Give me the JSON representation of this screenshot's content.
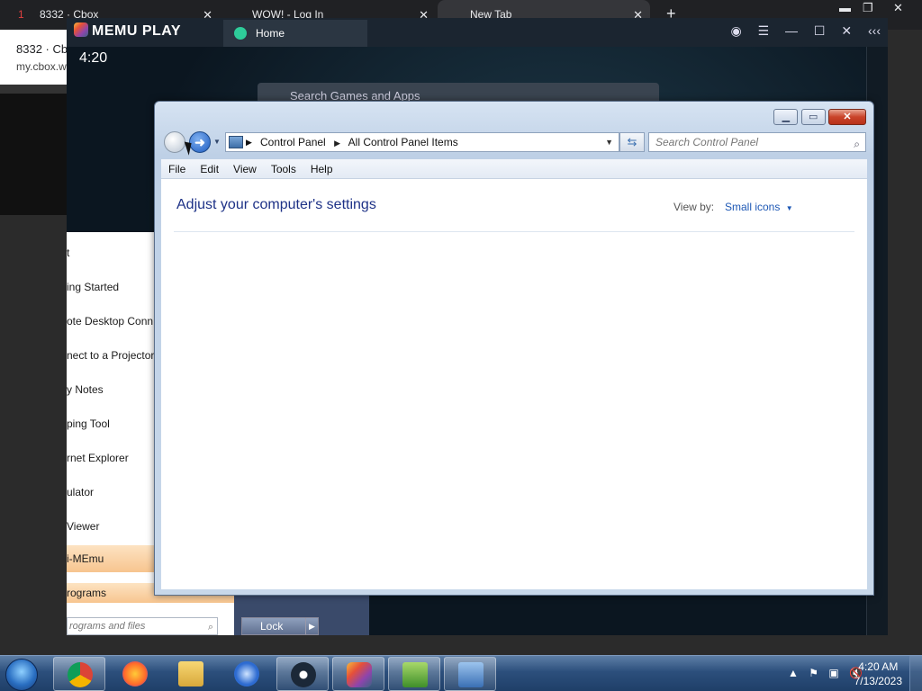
{
  "browser_tabs": [
    {
      "badge": "1",
      "label": "8332 · Cbox"
    },
    {
      "label": "WOW! - Log In"
    },
    {
      "label": "New Tab"
    }
  ],
  "bg_page": {
    "title": "8332 · Cb",
    "url": "my.cbox.w"
  },
  "memu": {
    "brand": "MEMU PLAY",
    "home_tab": "Home",
    "time": "4:20",
    "search_placeholder": "Search Games and Apps"
  },
  "start_menu": {
    "items": [
      "t",
      "ing Started",
      "ote Desktop Conn",
      "nect to a Projector",
      "y Notes",
      "ping Tool",
      "rnet Explorer",
      "ulator",
      "Viewer",
      "i-MEmu"
    ],
    "all_programs": "rograms",
    "search_placeholder": "rograms and files",
    "lock_label": "Lock"
  },
  "control_panel": {
    "breadcrumb": [
      "Control Panel",
      "All Control Panel Items"
    ],
    "search_placeholder": "Search Control Panel",
    "menu": [
      "File",
      "Edit",
      "View",
      "Tools",
      "Help"
    ],
    "heading": "Adjust your computer's settings",
    "view_by_label": "View by:",
    "view_by_value": "Small icons"
  },
  "taskbar": {
    "time": "4:20 AM",
    "date": "7/13/2023"
  },
  "icons": [
    "minimize-icon",
    "maximize-icon",
    "close-icon",
    "back-arrow-icon",
    "forward-arrow-icon",
    "refresh-icon",
    "search-icon",
    "chevron-down-icon"
  ]
}
